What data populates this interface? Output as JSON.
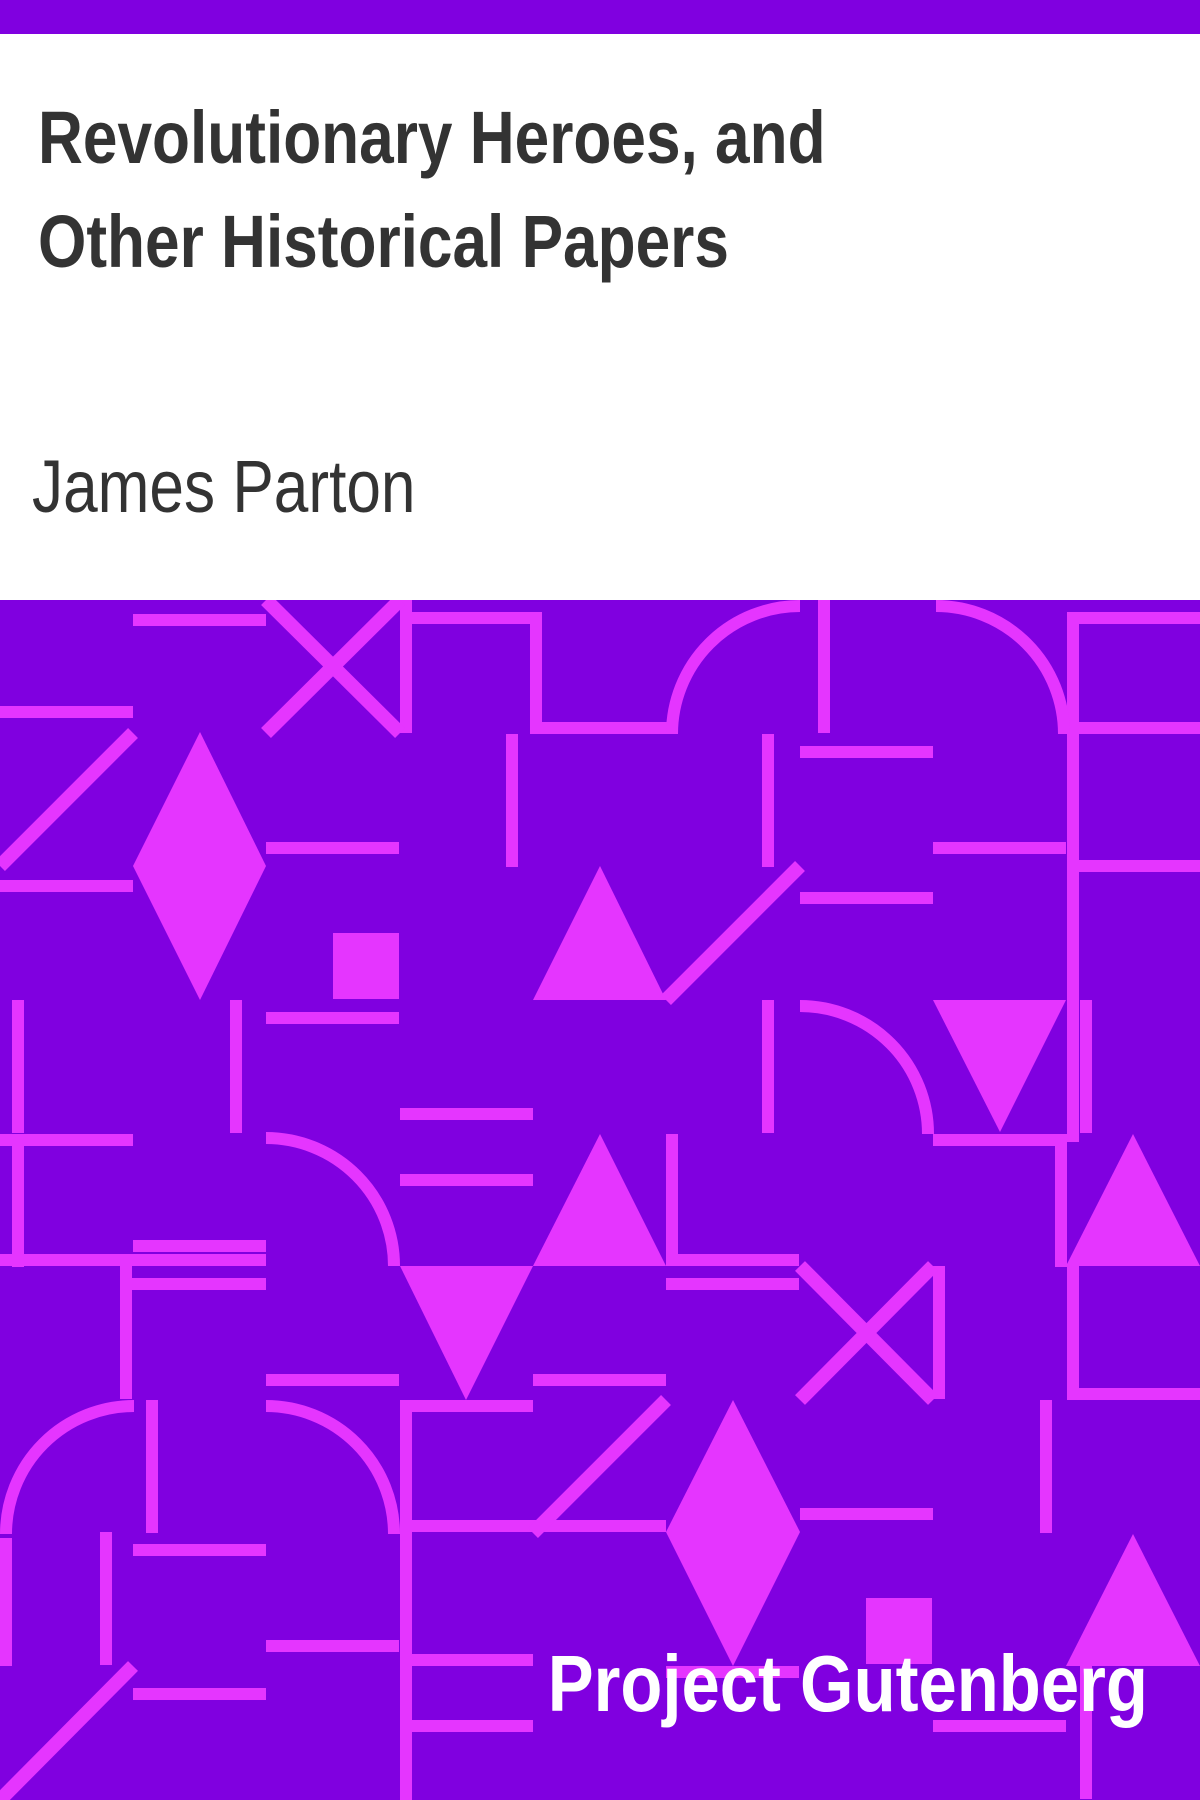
{
  "cover": {
    "title": "Revolutionary Heroes, and Other Historical Papers",
    "author": "James Parton",
    "publisher": "Project Gutenberg"
  },
  "colors": {
    "background": "#8000e0",
    "pattern": "#e535ff",
    "text": "#333333",
    "publisher_text": "#ffffff"
  }
}
